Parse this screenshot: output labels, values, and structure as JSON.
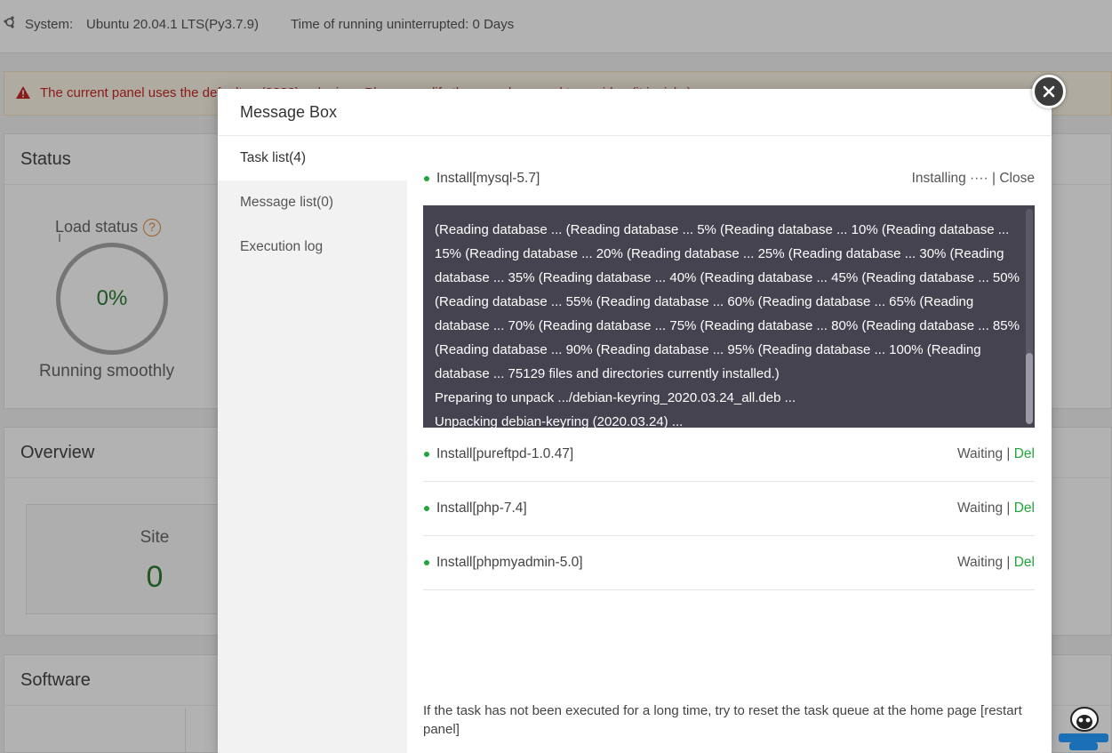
{
  "topbar": {
    "system_label": "System:",
    "system_value": "Ubuntu 20.04.1 LTS(Py3.7.9)",
    "uptime": "Time of running uninterrupted: 0 Days"
  },
  "warning": {
    "text": "The current panel uses the default ... (8888) ... login ... Please modify the ... and ... panel to avoid ... (it is risky)"
  },
  "status_card": {
    "title": "Status",
    "load_label": "Load status",
    "load_value": "0%",
    "load_percent": 0,
    "load_state": "Running smoothly"
  },
  "overview_card": {
    "title": "Overview",
    "site_label": "Site",
    "site_count": "0"
  },
  "software_card": {
    "title": "Software"
  },
  "modal": {
    "title": "Message Box",
    "nav": [
      {
        "label": "Task list(4)",
        "active": true
      },
      {
        "label": "Message list(0)",
        "active": false
      },
      {
        "label": "Execution log",
        "active": false
      }
    ],
    "current_task": {
      "name": "Install[mysql-5.7]",
      "status": "Installing ···· | ",
      "action": "Close"
    },
    "console_lines": [
      "(Reading database ... (Reading database ... 5% (Reading database ... 10% (Reading database ...",
      "15% (Reading database ... 20% (Reading database ... 25% (Reading database ... 30% (Reading",
      "database ... 35% (Reading database ... 40% (Reading database ... 45% (Reading database ... 50%",
      "(Reading database ... 55% (Reading database ... 60% (Reading database ... 65% (Reading",
      "database ... 70% (Reading database ... 75% (Reading database ... 80% (Reading database ... 85%",
      "(Reading database ... 90% (Reading database ... 95% (Reading database ... 100% (Reading",
      "database ... 75129 files and directories currently installed.)",
      "Preparing to unpack .../debian-keyring_2020.03.24_all.deb ...",
      "Unpacking debian-keyring (2020.03.24) ..."
    ],
    "queued_tasks": [
      {
        "name": "Install[pureftpd-1.0.47]",
        "status": "Waiting | ",
        "action": "Del"
      },
      {
        "name": "Install[php-7.4]",
        "status": "Waiting | ",
        "action": "Del"
      },
      {
        "name": "Install[phpmyadmin-5.0]",
        "status": "Waiting | ",
        "action": "Del"
      }
    ],
    "hint": "If the task has not been executed for a long time, try to reset the task queue at the home page [restart panel]"
  },
  "colors": {
    "accent_green": "#20a53a",
    "console_bg": "#44434f",
    "warning_red": "#c62828"
  },
  "icons": {
    "system": "ubuntu-gear-icon",
    "warning": "warning-triangle-icon",
    "help": "question-icon",
    "close": "close-icon",
    "logo": "one-smart-sheep-logo"
  }
}
